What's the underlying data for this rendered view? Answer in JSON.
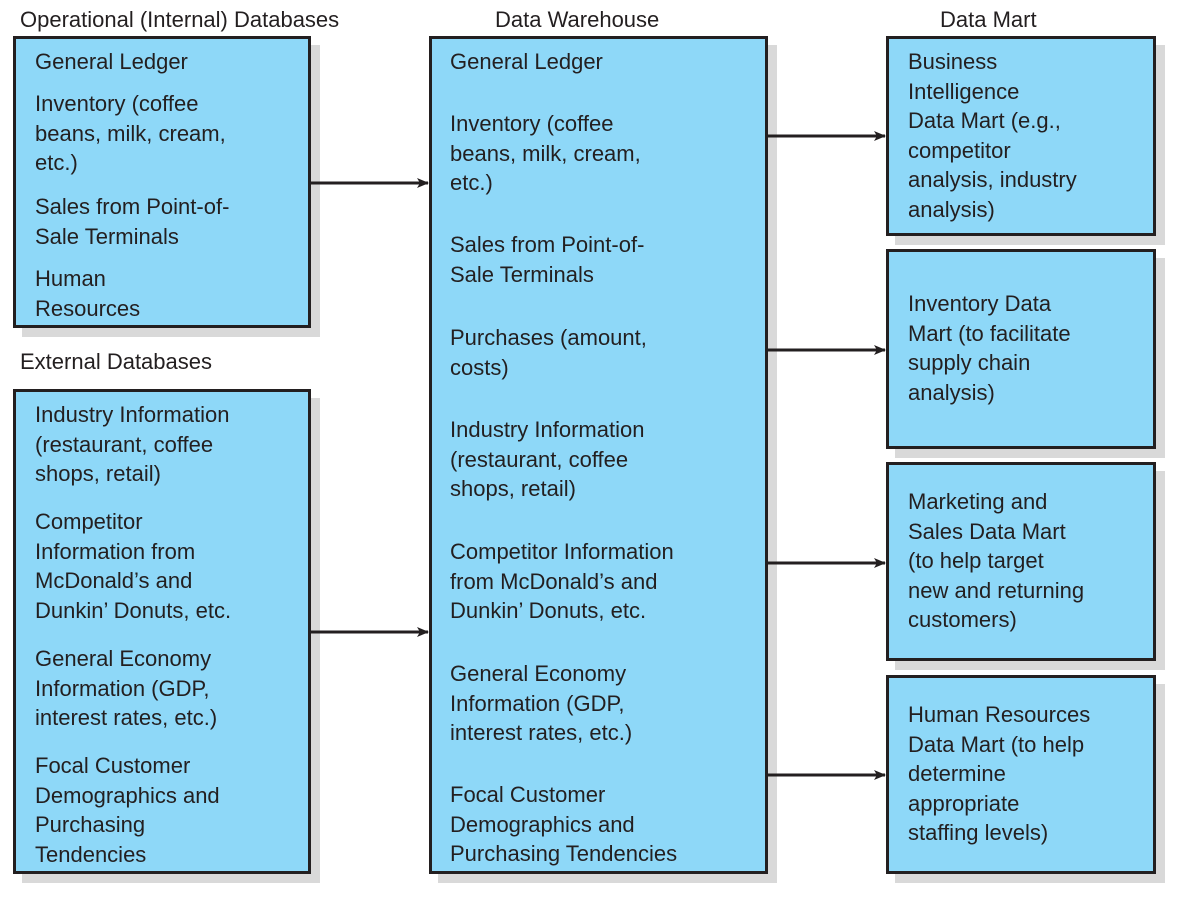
{
  "headers": {
    "operational": "Operational (Internal) Databases",
    "external": "External Databases",
    "warehouse": "Data Warehouse",
    "mart": "Data Mart"
  },
  "colors": {
    "box_fill": "#8ed8f8",
    "border": "#231f20",
    "shadow": "#d9d9d9"
  },
  "operational_items": [
    "General Ledger",
    "Inventory (coffee\nbeans, milk, cream,\netc.)",
    "Sales from Point-of-\nSale Terminals",
    "Human\nResources"
  ],
  "external_items": [
    "Industry Information\n(restaurant, coffee\nshops, retail)",
    "Competitor\nInformation from\nMcDonald’s and\nDunkin’ Donuts, etc.",
    "General Economy\nInformation (GDP,\ninterest rates, etc.)",
    "Focal Customer\nDemographics and\nPurchasing\nTendencies"
  ],
  "warehouse_items": [
    "General Ledger",
    "Inventory (coffee\nbeans, milk, cream,\netc.)",
    "Sales from Point-of-\nSale Terminals",
    "Purchases (amount,\ncosts)",
    "Industry Information\n(restaurant, coffee\nshops, retail)",
    "Competitor Information\nfrom McDonald’s and\nDunkin’ Donuts, etc.",
    "General Economy\nInformation (GDP,\ninterest rates, etc.)",
    "Focal Customer\nDemographics and\nPurchasing Tendencies"
  ],
  "marts": [
    "Business\nIntelligence\nData Mart (e.g.,\ncompetitor\nanalysis, industry\nanalysis)",
    "Inventory Data\nMart (to facilitate\nsupply chain\nanalysis)",
    "Marketing and\nSales Data Mart\n(to help target\nnew and returning\ncustomers)",
    "Human Resources\nData Mart (to help\ndetermine\nappropriate\nstaffing levels)"
  ]
}
